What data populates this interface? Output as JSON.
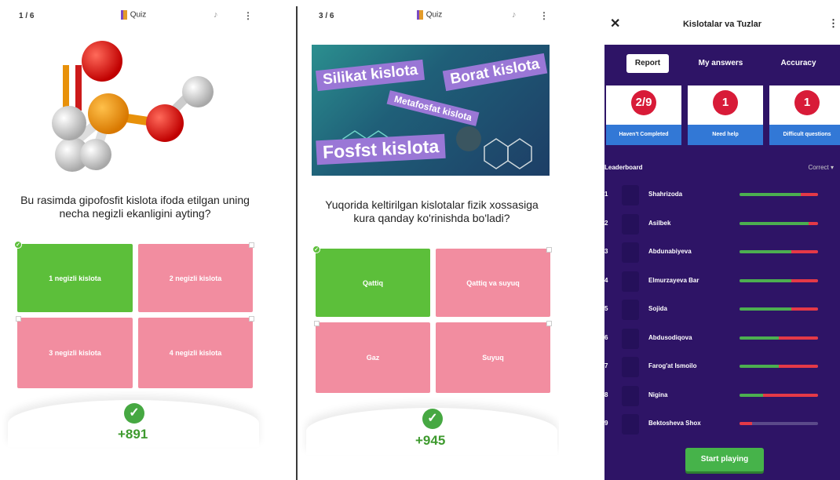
{
  "panel1": {
    "counter": "1 / 6",
    "app_label": "Quiz",
    "question": "Bu rasimda gipofosfit kislota ifoda etilgan uning necha negizli ekanligini ayting?",
    "options": [
      {
        "label": "1 negizli kislota",
        "state": "correct"
      },
      {
        "label": "2 negizli kislota",
        "state": "wrong"
      },
      {
        "label": "3 negizli kislota",
        "state": "wrong"
      },
      {
        "label": "4 negizli kislota",
        "state": "wrong"
      }
    ],
    "score": "+891"
  },
  "panel2": {
    "counter": "3 / 6",
    "app_label": "Quiz",
    "banner_tags": [
      "Silikat kislota",
      "Borat kislota",
      "Metafosfat kislota",
      "Fosfst kislota"
    ],
    "question": "Yuqorida keltirilgan kislotalar fizik xossasiga kura qanday ko'rinishda bo'ladi?",
    "options": [
      {
        "label": "Qattiq",
        "state": "correct"
      },
      {
        "label": "Qattiq va suyuq",
        "state": "wrong"
      },
      {
        "label": "Gaz",
        "state": "wrong"
      },
      {
        "label": "Suyuq",
        "state": "wrong"
      }
    ],
    "score": "+945"
  },
  "panel3": {
    "title": "Kislotalar va Tuzlar",
    "tabs": [
      "Report",
      "My answers",
      "Accuracy"
    ],
    "stats": [
      {
        "value": "2/9",
        "label": "Haven't Completed"
      },
      {
        "value": "1",
        "label": "Need help"
      },
      {
        "value": "1",
        "label": "Difficult questions"
      }
    ],
    "leaderboard_title": "Leaderboard",
    "sort_label": "Correct",
    "players": [
      {
        "rank": "1",
        "name": "Shahrizoda",
        "correct": 0.78,
        "wrong": 0.22
      },
      {
        "rank": "2",
        "name": "Asilbek",
        "correct": 0.88,
        "wrong": 0.12
      },
      {
        "rank": "3",
        "name": "Abdunabiyeva",
        "correct": 0.66,
        "wrong": 0.34
      },
      {
        "rank": "4",
        "name": "Elmurzayeva Bar",
        "correct": 0.66,
        "wrong": 0.34
      },
      {
        "rank": "5",
        "name": "Sojida",
        "correct": 0.66,
        "wrong": 0.34
      },
      {
        "rank": "6",
        "name": "Abdusodiqova",
        "correct": 0.5,
        "wrong": 0.5
      },
      {
        "rank": "7",
        "name": "Farog'at Ismoilo",
        "correct": 0.5,
        "wrong": 0.5
      },
      {
        "rank": "8",
        "name": "Nigina",
        "correct": 0.3,
        "wrong": 0.7
      },
      {
        "rank": "9",
        "name": "Bektosheva Shox",
        "correct": 0.0,
        "wrong": 0.16
      }
    ],
    "start_button": "Start playing"
  },
  "colors": {
    "correct": "#5cbf3a",
    "wrong": "#f28da0",
    "dashboard_bg": "#2e1466",
    "stat_circle": "#d81b38",
    "stat_label": "#3278d6",
    "start_button": "#46b34a"
  }
}
